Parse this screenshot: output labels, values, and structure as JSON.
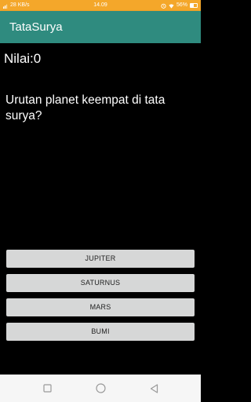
{
  "status_bar": {
    "network_speed": "28 KB/s",
    "time": "14.09",
    "battery": "56%",
    "battery_level": 0.56,
    "background_color": "#f4a72a",
    "icons": [
      "network-icon",
      "alarm-icon",
      "wifi-icon",
      "battery-icon"
    ]
  },
  "app_bar": {
    "title": "TataSurya",
    "color": "#2f8b7f"
  },
  "quiz": {
    "score_label": "Nilai:0",
    "question": "Urutan planet keempat di tata surya?",
    "answers": [
      "JUPITER",
      "SATURNUS",
      "MARS",
      "BUMI"
    ]
  },
  "nav_bar": {
    "icons": [
      "recent-apps-icon",
      "home-icon",
      "back-icon"
    ]
  }
}
